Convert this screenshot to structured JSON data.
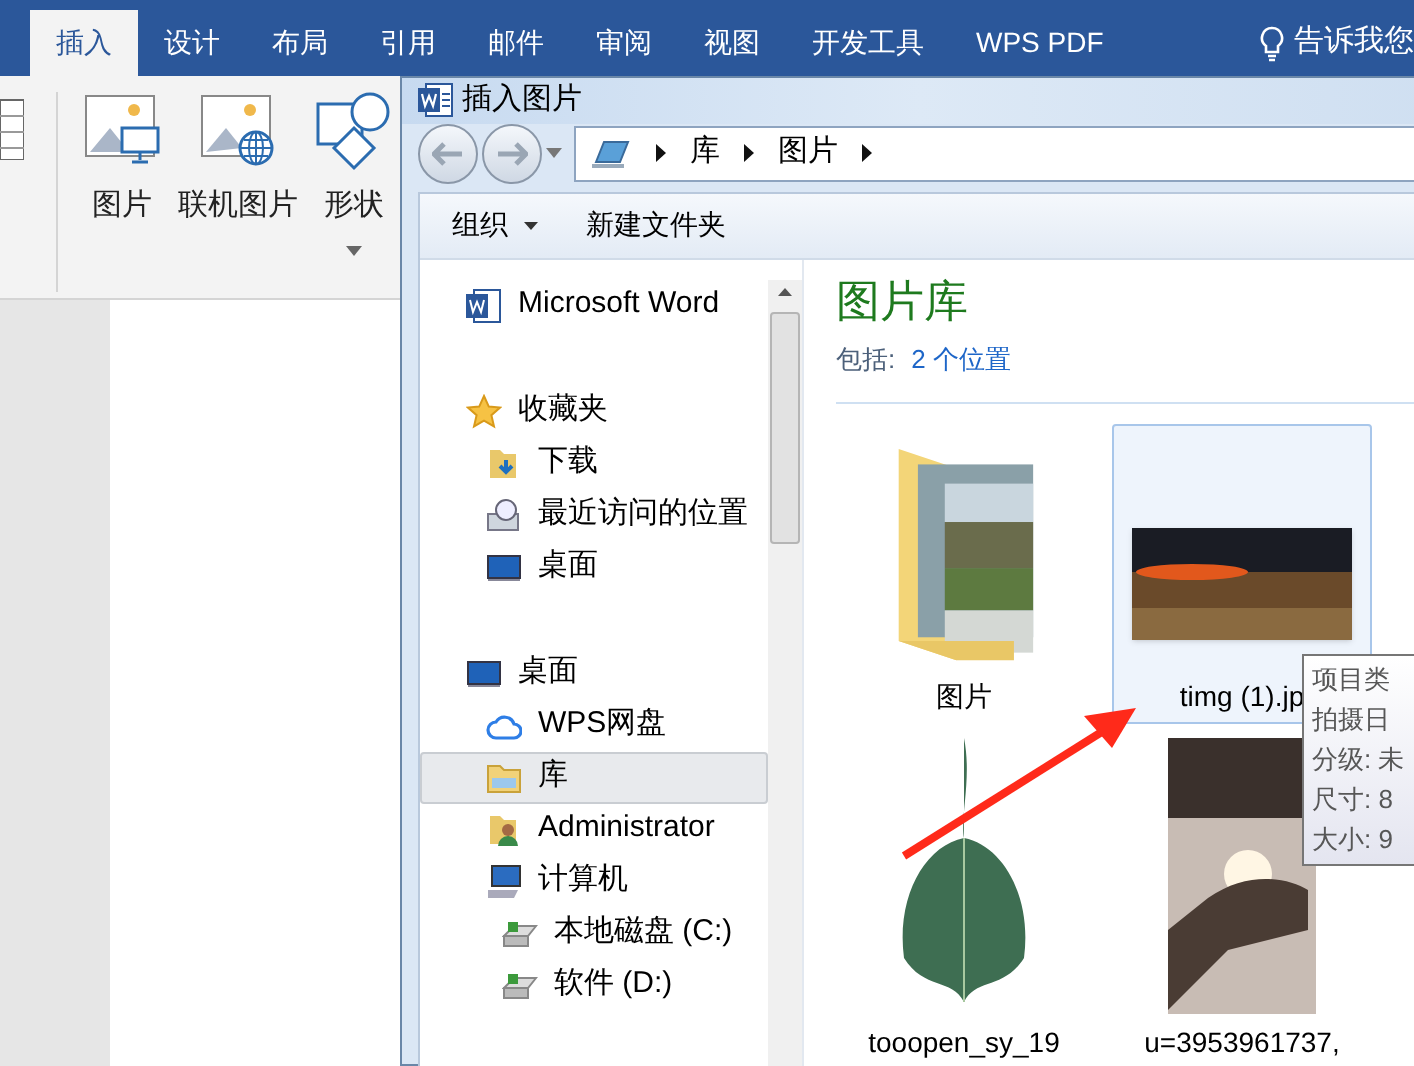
{
  "word": {
    "tabs": [
      {
        "label": "插入",
        "selected": true
      },
      {
        "label": "设计",
        "selected": false
      },
      {
        "label": "布局",
        "selected": false
      },
      {
        "label": "引用",
        "selected": false
      },
      {
        "label": "邮件",
        "selected": false
      },
      {
        "label": "审阅",
        "selected": false
      },
      {
        "label": "视图",
        "selected": false
      },
      {
        "label": "开发工具",
        "selected": false
      },
      {
        "label": "WPS PDF",
        "selected": false
      }
    ],
    "tell_me": "告诉我您",
    "ribbon": {
      "buttons": [
        {
          "kind": "picture",
          "label": "图片"
        },
        {
          "kind": "online",
          "label": "联机图片"
        },
        {
          "kind": "shapes",
          "label": "形状"
        }
      ]
    }
  },
  "dialog": {
    "title": "插入图片",
    "breadcrumb": [
      "库",
      "图片"
    ],
    "toolbar": {
      "organize": "组织",
      "new_folder": "新建文件夹"
    },
    "nav_groups": [
      [
        {
          "kind": "word",
          "label": "Microsoft Word",
          "selected": false
        }
      ],
      [
        {
          "kind": "star",
          "label": "收藏夹",
          "selected": false,
          "children": [
            {
              "kind": "download",
              "label": "下载",
              "selected": false
            },
            {
              "kind": "recent",
              "label": "最近访问的位置",
              "selected": false
            },
            {
              "kind": "desktop",
              "label": "桌面",
              "selected": false
            }
          ]
        }
      ],
      [
        {
          "kind": "desktop",
          "label": "桌面",
          "selected": false,
          "children": [
            {
              "kind": "cloud",
              "label": "WPS网盘",
              "selected": false
            },
            {
              "kind": "library",
              "label": "库",
              "selected": true
            },
            {
              "kind": "user",
              "label": "Administrator",
              "selected": false
            },
            {
              "kind": "computer",
              "label": "计算机",
              "selected": false,
              "children": [
                {
                  "kind": "disk",
                  "label": "本地磁盘 (C:)",
                  "selected": false
                },
                {
                  "kind": "disk",
                  "label": "软件 (D:)",
                  "selected": false
                }
              ]
            }
          ]
        }
      ]
    ],
    "library_title": "图片库",
    "includes_label": "包括:",
    "includes_link": "2 个位置",
    "files": [
      {
        "kind": "folder",
        "name": "图片",
        "selected": false
      },
      {
        "kind": "sunset",
        "name": "timg (1).jp",
        "selected": true
      },
      {
        "kind": "leaf",
        "name": "tooopen_sy_19",
        "selected": false
      },
      {
        "kind": "night",
        "name": "u=3953961737,",
        "selected": false
      }
    ],
    "tooltip": [
      "项目类",
      "拍摄日",
      "分级: 未",
      "尺寸: 8",
      "大小: 9"
    ]
  }
}
